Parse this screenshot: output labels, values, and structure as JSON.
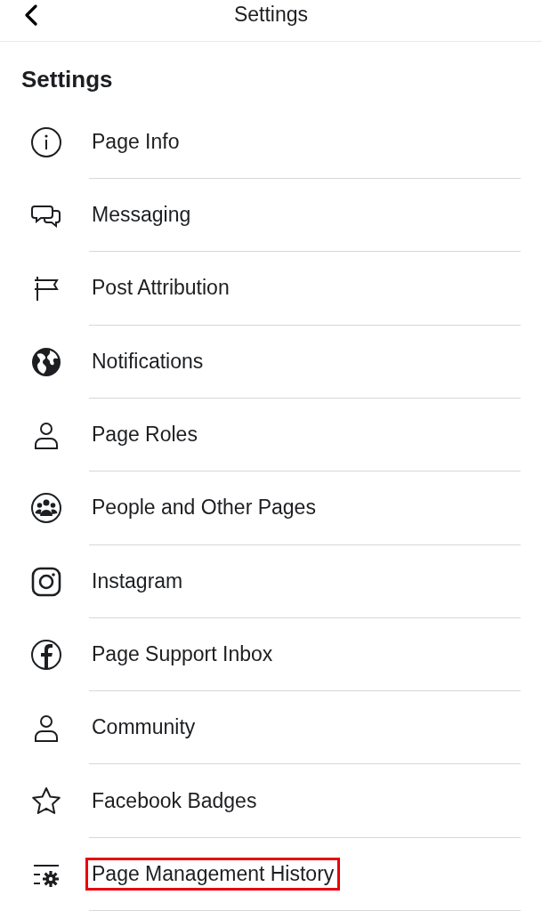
{
  "header": {
    "title": "Settings"
  },
  "heading": "Settings",
  "items": [
    {
      "kind": "info",
      "label": "Page Info",
      "highlighted": false
    },
    {
      "kind": "chat",
      "label": "Messaging",
      "highlighted": false
    },
    {
      "kind": "flag",
      "label": "Post Attribution",
      "highlighted": false
    },
    {
      "kind": "globe",
      "label": "Notifications",
      "highlighted": false
    },
    {
      "kind": "person",
      "label": "Page Roles",
      "highlighted": false
    },
    {
      "kind": "group",
      "label": "People and Other Pages",
      "highlighted": false
    },
    {
      "kind": "instagram",
      "label": "Instagram",
      "highlighted": false
    },
    {
      "kind": "facebook",
      "label": "Page Support Inbox",
      "highlighted": false
    },
    {
      "kind": "person",
      "label": "Community",
      "highlighted": false
    },
    {
      "kind": "star",
      "label": "Facebook Badges",
      "highlighted": false
    },
    {
      "kind": "gearlist",
      "label": "Page Management History",
      "highlighted": true
    }
  ]
}
